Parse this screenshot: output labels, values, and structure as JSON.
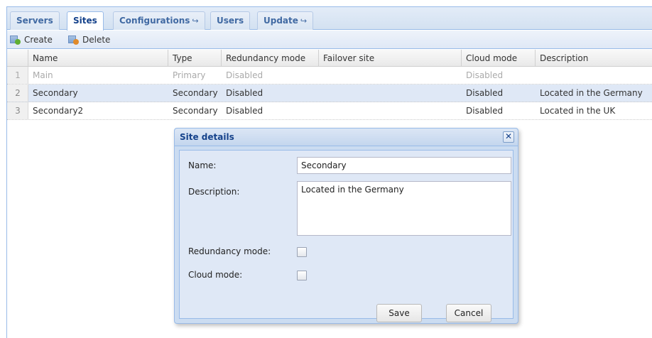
{
  "tabs": [
    {
      "label": "Servers",
      "arrow": ""
    },
    {
      "label": "Sites",
      "arrow": ""
    },
    {
      "label": "Configurations",
      "arrow": "↪"
    },
    {
      "label": "Users",
      "arrow": ""
    },
    {
      "label": "Update",
      "arrow": "↪"
    }
  ],
  "toolbar": {
    "create_label": "Create",
    "delete_label": "Delete"
  },
  "grid": {
    "columns": [
      "Name",
      "Type",
      "Redundancy mode",
      "Failover site",
      "Cloud mode",
      "Description"
    ],
    "rows": [
      {
        "num": "1",
        "name": "Main",
        "type": "Primary",
        "redundancy": "Disabled",
        "failover": "",
        "cloud": "Disabled",
        "description": ""
      },
      {
        "num": "2",
        "name": "Secondary",
        "type": "Secondary",
        "redundancy": "Disabled",
        "failover": "",
        "cloud": "Disabled",
        "description": "Located in the Germany"
      },
      {
        "num": "3",
        "name": "Secondary2",
        "type": "Secondary",
        "redundancy": "Disabled",
        "failover": "",
        "cloud": "Disabled",
        "description": "Located in the UK"
      }
    ]
  },
  "dialog": {
    "title": "Site details",
    "close_glyph": "✕",
    "name_label": "Name:",
    "name_value": "Secondary",
    "description_label": "Description:",
    "description_value": "Located in the Germany",
    "redundancy_label": "Redundancy mode:",
    "redundancy_checked": false,
    "cloud_label": "Cloud mode:",
    "cloud_checked": false,
    "save_label": "Save",
    "cancel_label": "Cancel"
  },
  "colors": {
    "accent": "#15428b",
    "border": "#99bbe8",
    "selected_row": "#dfe8f6"
  }
}
